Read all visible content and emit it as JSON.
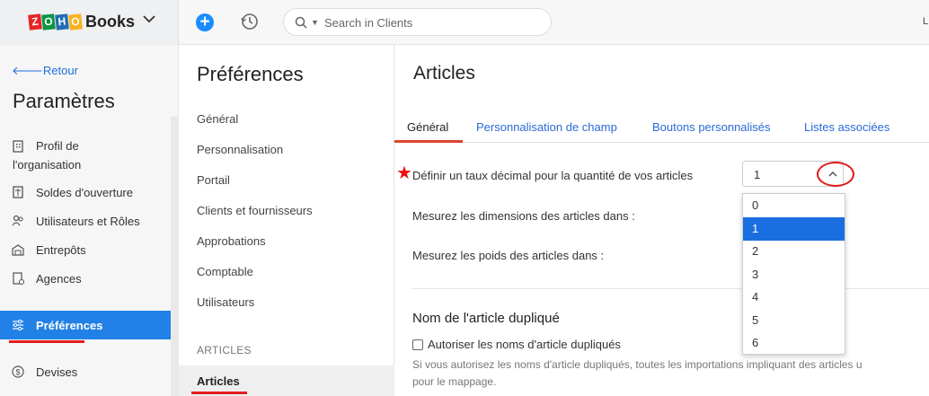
{
  "brand": {
    "logo_letters": [
      "Z",
      "O",
      "H",
      "O"
    ],
    "logo_colors": [
      "#e42527",
      "#0b9444",
      "#226db4",
      "#f9b21d"
    ],
    "app_name": "Books"
  },
  "header": {
    "search_placeholder": "Search in Clients",
    "user_initial": "L"
  },
  "sidebar": {
    "back_label": "Retour",
    "title": "Paramètres",
    "items": [
      {
        "label": "Profil de",
        "label2": "l'organisation"
      },
      {
        "label": "Soldes d'ouverture"
      },
      {
        "label": "Utilisateurs et Rôles"
      },
      {
        "label": "Entrepôts"
      },
      {
        "label": "Agences"
      },
      {
        "label": "Préférences"
      },
      {
        "label": "Devises"
      }
    ]
  },
  "preferences": {
    "title": "Préférences",
    "items": [
      "Général",
      "Personnalisation",
      "Portail",
      "Clients et fournisseurs",
      "Approbations",
      "Comptable",
      "Utilisateurs"
    ],
    "section_header": "ARTICLES",
    "active_item": "Articles"
  },
  "main": {
    "title": "Articles",
    "tabs": [
      "Général",
      "Personnalisation de champ",
      "Boutons personnalisés",
      "Listes associées"
    ],
    "active_tab": "Général",
    "star": "★",
    "decimal_label": "Définir un taux décimal pour la quantité de vos articles",
    "decimal_value": "1",
    "decimal_options": [
      "0",
      "1",
      "2",
      "3",
      "4",
      "5",
      "6"
    ],
    "dimensions_label": "Mesurez les dimensions des articles dans :",
    "weight_label": "Mesurez les poids des articles dans :",
    "duplicate_title": "Nom de l'article dupliqué",
    "duplicate_checkbox": "Autoriser les noms d'article dupliqués",
    "duplicate_note_line1": "Si vous autorisez les noms d'article dupliqués, toutes les importations impliquant des articles u",
    "duplicate_note_line2": "pour le mappage."
  },
  "colors": {
    "accent": "#2281e6",
    "highlight": "#e02020"
  }
}
